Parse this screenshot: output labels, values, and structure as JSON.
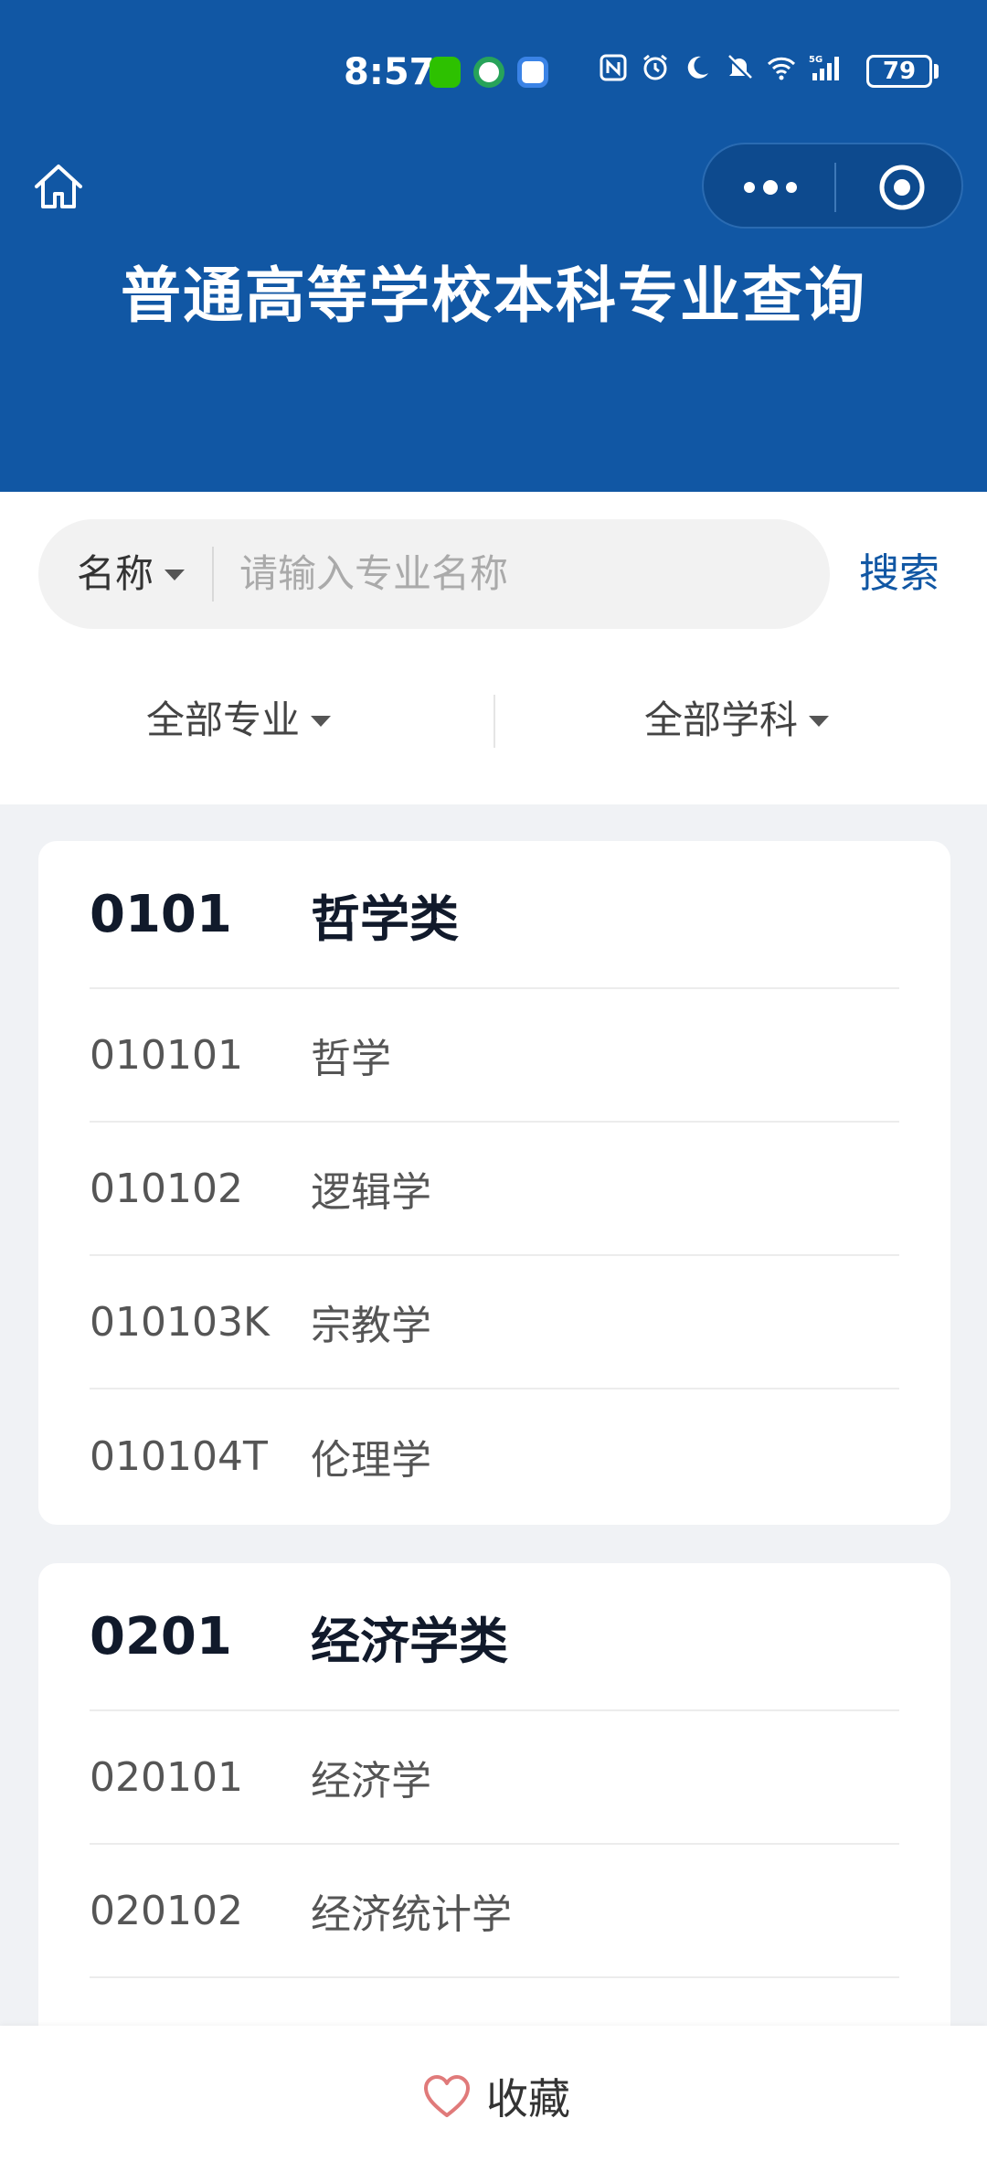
{
  "status_bar": {
    "time": "8:57",
    "battery": "79",
    "network": "5G",
    "icons": [
      "wechat-icon",
      "app-icon",
      "app-icon",
      "nfc-icon",
      "alarm-icon",
      "moon-icon",
      "mute-icon",
      "wifi-icon",
      "signal-icon"
    ]
  },
  "header": {
    "title": "普通高等学校本科专业查询",
    "bg_color": "#1157a4"
  },
  "search": {
    "type_label": "名称",
    "placeholder": "请输入专业名称",
    "button_label": "搜索"
  },
  "filters": {
    "major": "全部专业",
    "subject": "全部学科"
  },
  "groups": [
    {
      "code": "0101",
      "name": "哲学类",
      "items": [
        {
          "code": "010101",
          "name": "哲学"
        },
        {
          "code": "010102",
          "name": "逻辑学"
        },
        {
          "code": "010103K",
          "name": "宗教学"
        },
        {
          "code": "010104T",
          "name": "伦理学"
        }
      ]
    },
    {
      "code": "0201",
      "name": "经济学类",
      "items": [
        {
          "code": "020101",
          "name": "经济学"
        },
        {
          "code": "020102",
          "name": "经济统计学"
        }
      ]
    }
  ],
  "bottom": {
    "favorite_label": "收藏"
  }
}
